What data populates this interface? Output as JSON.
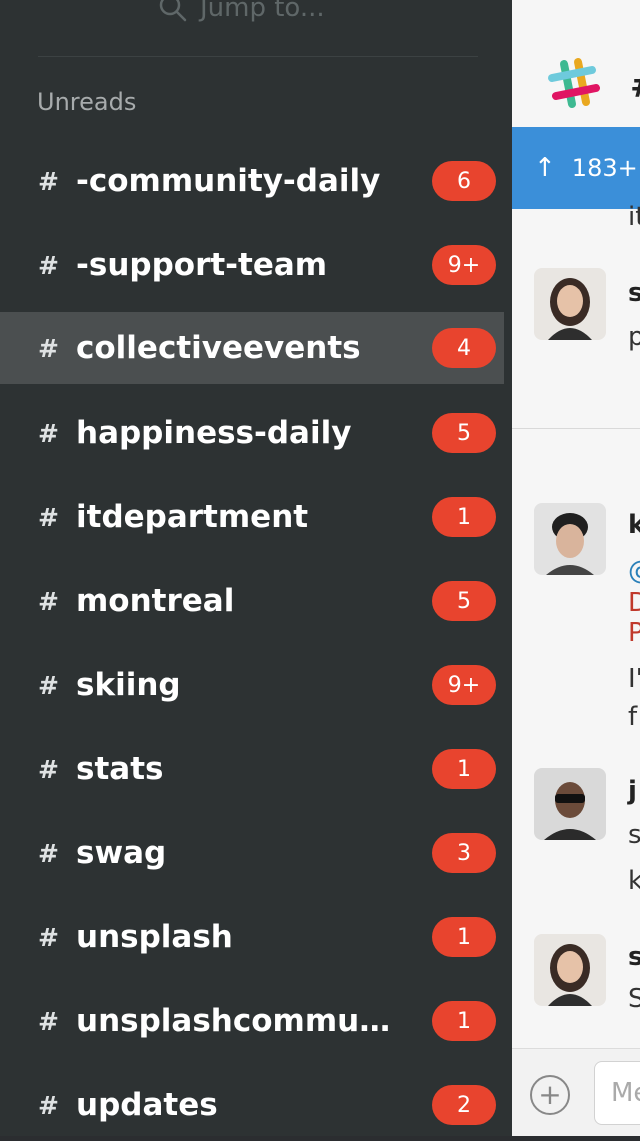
{
  "search": {
    "placeholder": "Jump to..."
  },
  "sidebar": {
    "section_label": "Unreads",
    "channels": [
      {
        "name": "-community-daily",
        "badge": "6"
      },
      {
        "name": "-support-team",
        "badge": "9+"
      },
      {
        "name": "collectiveevents",
        "badge": "4"
      },
      {
        "name": "happiness-daily",
        "badge": "5"
      },
      {
        "name": "itdepartment",
        "badge": "1"
      },
      {
        "name": "montreal",
        "badge": "5"
      },
      {
        "name": "skiing",
        "badge": "9+"
      },
      {
        "name": "stats",
        "badge": "1"
      },
      {
        "name": "swag",
        "badge": "3"
      },
      {
        "name": "unsplash",
        "badge": "1"
      },
      {
        "name": "unsplashcommuni…",
        "badge": "1"
      },
      {
        "name": "updates",
        "badge": "2"
      }
    ],
    "selected_index": 2
  },
  "main": {
    "header_hash": "#",
    "new_messages_banner": "183+",
    "fragments": [
      "it",
      "s",
      "p",
      "k",
      "@",
      "D",
      "P",
      "I'",
      "f",
      "j",
      "s",
      "k",
      "s",
      "S"
    ],
    "composer_placeholder": "Me"
  },
  "colors": {
    "badge": "#e8442e",
    "sidebar_bg": "#2d3233",
    "banner": "#3b8fd9"
  }
}
